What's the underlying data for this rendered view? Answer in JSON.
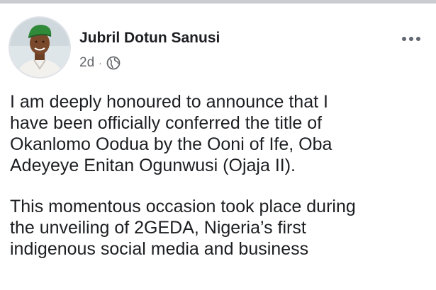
{
  "post": {
    "author": {
      "name": "Jubril Dotun Sanusi",
      "avatar_icon": "profile-photo"
    },
    "timestamp": "2d",
    "separator": "·",
    "audience_icon": "globe-icon",
    "more_icon": "more-options-icon",
    "paragraphs": [
      "I am deeply honoured to announce that I\nhave been officially conferred the title of\nOkanlomo Oodua by the Ooni of Ife, Oba\nAdeyeye Enitan Ogunwusi (Ojaja II).",
      "This momentous occasion took place during\nthe unveiling of 2GEDA, Nigeria’s first\nindigenous social media and business"
    ]
  }
}
